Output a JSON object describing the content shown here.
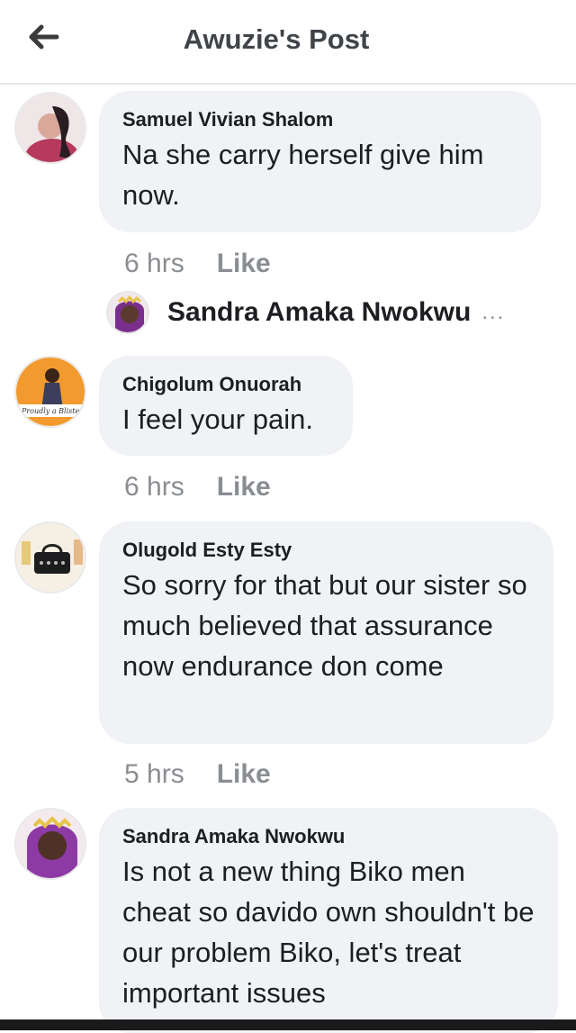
{
  "header": {
    "title": "Awuzie's Post",
    "back_icon": "arrow-left-icon"
  },
  "comments": [
    {
      "author": "Samuel Vivian Shalom",
      "text": "Na she carry herself give him now.",
      "time": "6 hrs",
      "like": "Like"
    },
    {
      "author": "Chigolum Onuorah",
      "text": "I feel your pain.",
      "time": "6 hrs",
      "like": "Like"
    },
    {
      "author": "Olugold Esty Esty",
      "text": "So sorry for that but our sister so much believed that assurance now endurance don come",
      "time": "5 hrs",
      "like": "Like"
    },
    {
      "author": "Sandra Amaka Nwokwu",
      "text": "Is not a new thing Biko men cheat so davido own shouldn't be our problem Biko, let's treat important issues"
    }
  ],
  "reply_preview": {
    "author": "Sandra Amaka Nwokwu",
    "more": "..."
  },
  "avatar_badge_text": "Proudly a Blister"
}
